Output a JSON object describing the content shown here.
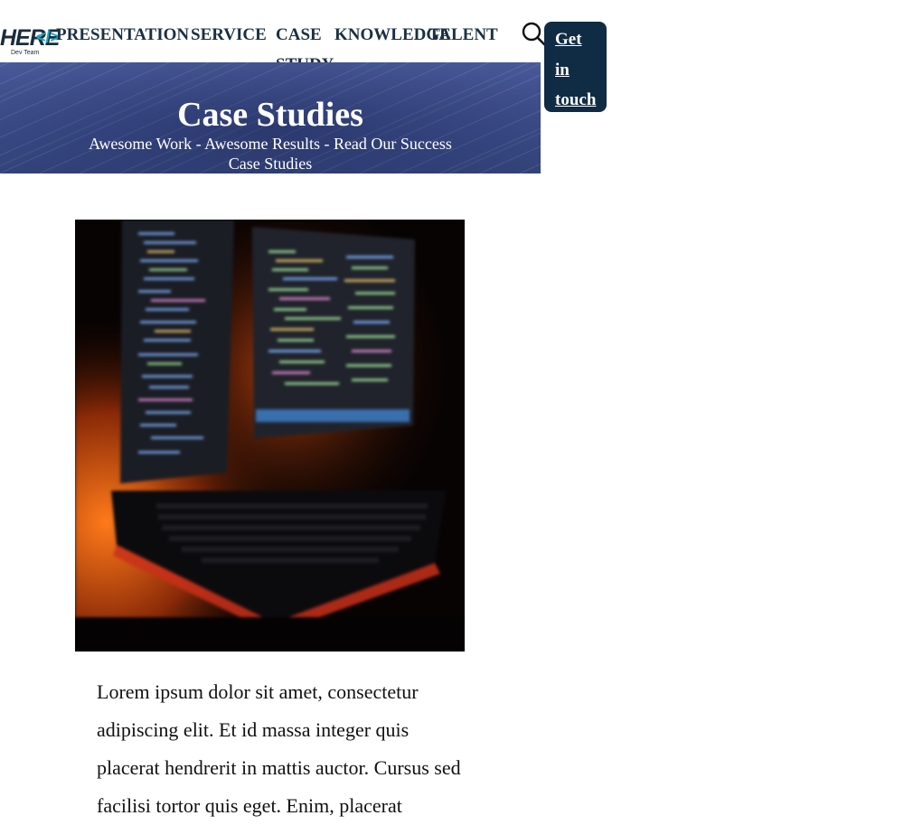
{
  "brand": {
    "logo_text": "HERE",
    "logo_tag": "</>",
    "logo_subtext": "Dev Team",
    "accent_color": "#1aa8c7",
    "dark_color": "#0f2c44"
  },
  "nav": {
    "items": [
      {
        "label": "PRESENTATION"
      },
      {
        "label": "SERVICE"
      },
      {
        "label_line1": "CASE",
        "label_line2": "STUDY"
      },
      {
        "label": "KNOWLEDGE"
      },
      {
        "label": "TALENT"
      }
    ],
    "search_icon": "search-icon",
    "cta_label": "Get in touch"
  },
  "hero": {
    "title": "Case Studies",
    "subtitle": "Awesome Work - Awesome Results - Read Our Success Case Studies"
  },
  "content": {
    "image_description": "laptop-with-code-monitors",
    "paragraph": "Lorem ipsum dolor sit amet, consectetur adipiscing elit. Et id massa integer quis placerat hendrerit in mattis auctor. Cursus sed facilisi tortor quis eget. Enim, placerat"
  }
}
